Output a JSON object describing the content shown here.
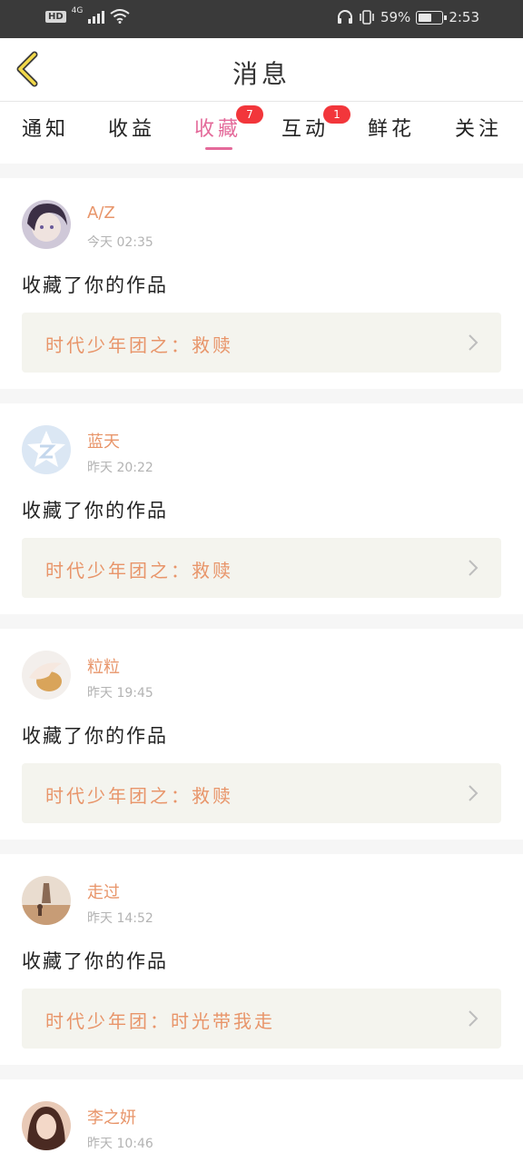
{
  "status_bar": {
    "hd": "HD",
    "network": "4G",
    "battery_percent": "59%",
    "battery_level": 0.59,
    "time": "2:53"
  },
  "header": {
    "title": "消息",
    "back_icon": "back-chevron-icon"
  },
  "tabs": [
    {
      "label": "通知",
      "badge": "",
      "active": false
    },
    {
      "label": "收益",
      "badge": "",
      "active": false
    },
    {
      "label": "收藏",
      "badge": "7",
      "active": true
    },
    {
      "label": "互动",
      "badge": "1",
      "active": false
    },
    {
      "label": "鲜花",
      "badge": "",
      "active": false
    },
    {
      "label": "关注",
      "badge": "",
      "active": false
    }
  ],
  "accent_color": "#e46a9a",
  "name_color": "#e8956a",
  "badge_color": "#f2363b",
  "messages": [
    {
      "user": "A/Z",
      "time": "今天 02:35",
      "action": "收藏了你的作品",
      "work": "时代少年团之：救赎"
    },
    {
      "user": "蓝天",
      "time": "昨天 20:22",
      "action": "收藏了你的作品",
      "work": "时代少年团之：救赎"
    },
    {
      "user": "粒粒",
      "time": "昨天 19:45",
      "action": "收藏了你的作品",
      "work": "时代少年团之：救赎"
    },
    {
      "user": "走过",
      "time": "昨天 14:52",
      "action": "收藏了你的作品",
      "work": "时代少年团：时光带我走"
    },
    {
      "user": "李之妍",
      "time": "昨天 10:46",
      "action": "",
      "work": ""
    }
  ]
}
